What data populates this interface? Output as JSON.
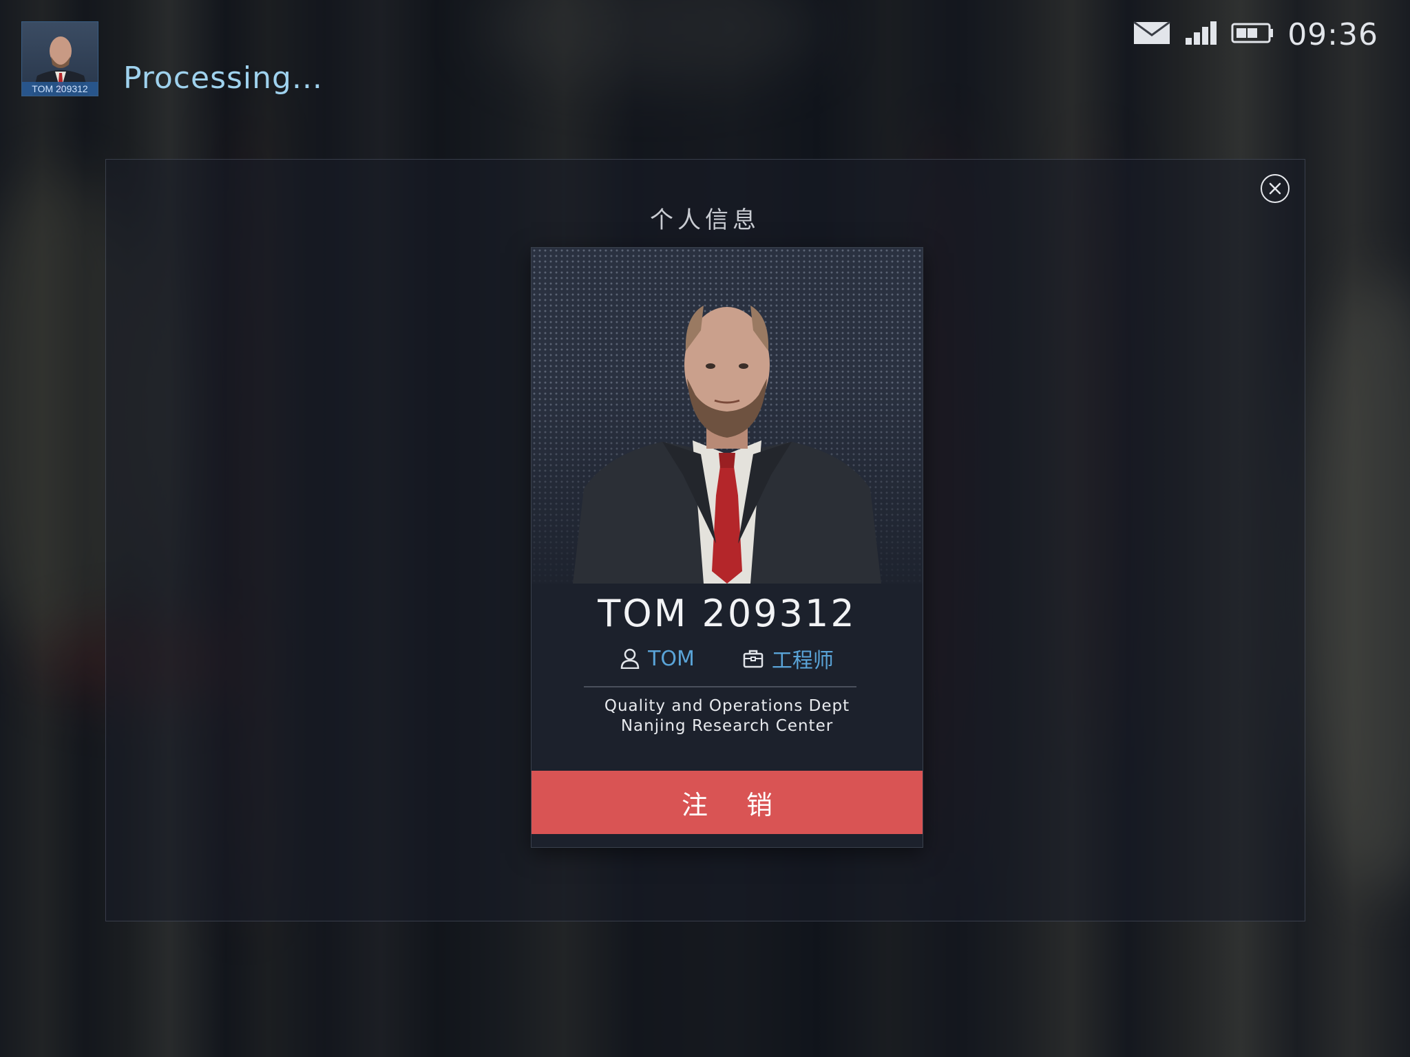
{
  "header": {
    "avatar_tag": "TOM 209312",
    "status_text": "Processing...",
    "time": "09:36"
  },
  "status_icons": [
    "mail-icon",
    "signal-icon",
    "battery-icon"
  ],
  "dialog": {
    "title": "个人信息",
    "close_icon": "close-icon"
  },
  "profile": {
    "name_id": "TOM 209312",
    "username": "TOM",
    "role": "工程师",
    "department_line1": "Quality and Operations Dept",
    "department_line2": "Nanjing Research Center",
    "logout_label": "注 销"
  },
  "colors": {
    "accent": "#5aa4d8",
    "processing_text": "#9fd2ee",
    "logout_button": "#d95454",
    "card_background": "#1c212c"
  }
}
